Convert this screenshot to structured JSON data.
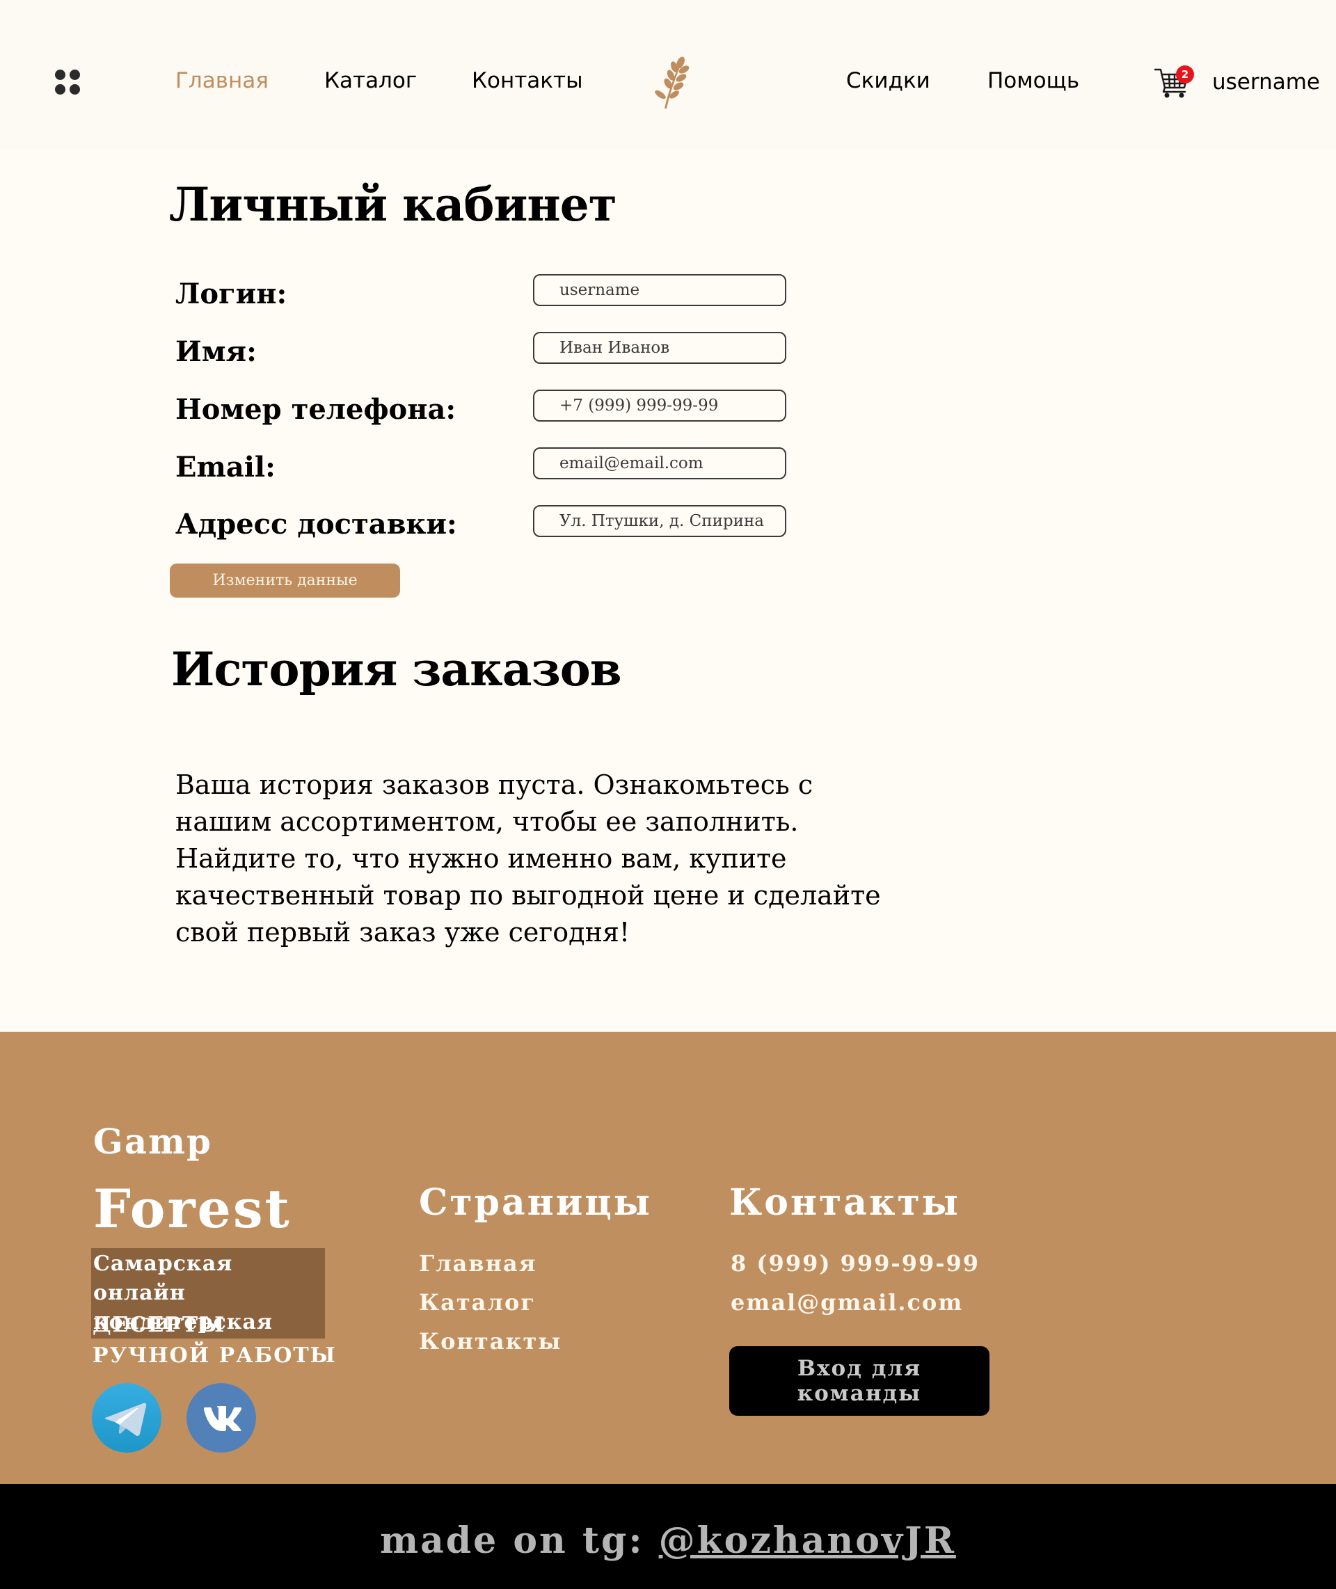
{
  "header": {
    "nav_left": [
      "Главная",
      "Каталог",
      "Контакты"
    ],
    "nav_right": [
      "Скидки",
      "Помощь"
    ],
    "active_item": "Главная",
    "cart_count": "2",
    "username": "username",
    "accent_color": "#C08E5E",
    "icons": {
      "menu": "grid-dots-icon",
      "logo": "wheat-icon",
      "cart": "shopping-cart-icon"
    }
  },
  "profile": {
    "title": "Личный кабинет",
    "fields": [
      {
        "label": "Логин:",
        "value": "username"
      },
      {
        "label": "Имя:",
        "value": "Иван Иванов"
      },
      {
        "label": "Номер телефона:",
        "value": "+7 (999) 999-99-99"
      },
      {
        "label": "Email:",
        "value": "email@email.com"
      },
      {
        "label": "Адресс доставки:",
        "value": "Ул. Птушки, д. Спирина"
      }
    ],
    "edit_button": "Изменить данные"
  },
  "history": {
    "title": "История заказов",
    "empty_text": "Ваша история заказов пуста. Ознакомьтесь с нашим ассортиментом, чтобы ее заполнить. Найдите то, что нужно именно вам, купите качественный товар по выгодной цене и сделайте свой первый заказ уже сегодня!"
  },
  "footer": {
    "background_color": "#C08F5F",
    "brand_small": "Gamp",
    "brand_large": "Forest",
    "tagline": "Самарская онлайн кондитерская",
    "subtagline": "ДЕСЕРТЫ РУЧНОЙ РАБОТЫ",
    "social": [
      "telegram-icon",
      "vk-icon"
    ],
    "pages_title": "Страницы",
    "pages": [
      "Главная",
      "Каталог",
      "Контакты"
    ],
    "contacts_title": "Контакты",
    "phone": "8 (999) 999-99-99",
    "email": "emal@gmail.com",
    "team_button": "Вход для команды"
  },
  "bottom_bar": {
    "prefix": "made on tg: ",
    "handle": "@kozhanovJR"
  }
}
